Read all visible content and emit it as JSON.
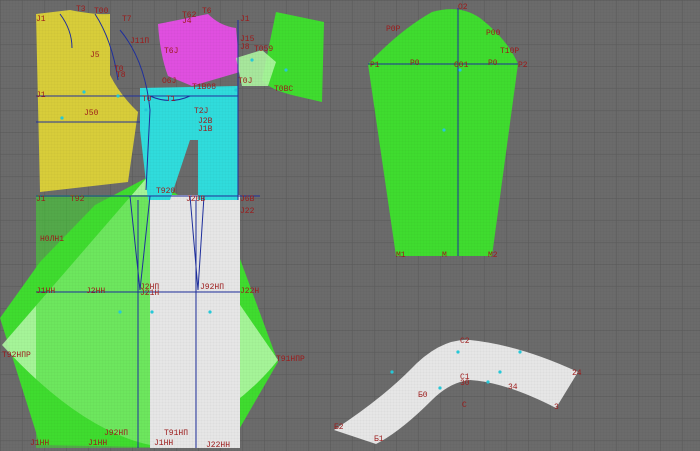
{
  "colors": {
    "background": "#6b6b6b",
    "grid": "#5b5b5b",
    "yellow": "#d8cd3a",
    "magenta": "#e04fe0",
    "cyan": "#30dcdc",
    "green": "#3fdc2f",
    "light_green": "#aef5a2",
    "white_grey": "#e6e6e6",
    "line_blue": "#1f2f9c",
    "label_red": "#9c1a1a",
    "point": "#25c8d8"
  },
  "labels": [
    {
      "text": "J1",
      "color": "red"
    },
    {
      "text": "T3",
      "color": "red"
    },
    {
      "text": "T00",
      "color": "red"
    },
    {
      "text": "T7",
      "color": "red"
    },
    {
      "text": "T62",
      "color": "red"
    },
    {
      "text": "T6",
      "color": "red"
    },
    {
      "text": "J4",
      "color": "red"
    },
    {
      "text": "J1",
      "color": "red"
    },
    {
      "text": "J11П",
      "color": "red"
    },
    {
      "text": "T6J",
      "color": "red"
    },
    {
      "text": "J15",
      "color": "red"
    },
    {
      "text": "J8",
      "color": "red"
    },
    {
      "text": "T059",
      "color": "red"
    },
    {
      "text": "T0ВС",
      "color": "red"
    },
    {
      "text": "T0J",
      "color": "red"
    },
    {
      "text": "О6J",
      "color": "red"
    },
    {
      "text": "J5",
      "color": "red"
    },
    {
      "text": "T0",
      "color": "red"
    },
    {
      "text": "T8",
      "color": "red"
    },
    {
      "text": "J1",
      "color": "red"
    },
    {
      "text": "T1",
      "color": "red"
    },
    {
      "text": "Т0",
      "color": "red"
    },
    {
      "text": "Т1В08",
      "color": "red"
    },
    {
      "text": "J50",
      "color": "red"
    },
    {
      "text": "Т2J",
      "color": "red"
    },
    {
      "text": "J2В",
      "color": "red"
    },
    {
      "text": "J1В",
      "color": "red"
    },
    {
      "text": "J1",
      "color": "red"
    },
    {
      "text": "T92",
      "color": "red"
    },
    {
      "text": "Т920",
      "color": "red"
    },
    {
      "text": "J20В",
      "color": "red"
    },
    {
      "text": "J6В",
      "color": "red"
    },
    {
      "text": "J22",
      "color": "red"
    },
    {
      "text": "Н0ЛН1",
      "color": "red"
    },
    {
      "text": "J1НН",
      "color": "red"
    },
    {
      "text": "J2НН",
      "color": "red"
    },
    {
      "text": "J2НП",
      "color": "red"
    },
    {
      "text": "J21Н",
      "color": "red"
    },
    {
      "text": "J22Н",
      "color": "red"
    },
    {
      "text": "J92НП",
      "color": "red"
    },
    {
      "text": "Т92НПР",
      "color": "red"
    },
    {
      "text": "T91НПР",
      "color": "red"
    },
    {
      "text": "J92НП",
      "color": "red"
    },
    {
      "text": "J1НН",
      "color": "red"
    },
    {
      "text": "Т91НП",
      "color": "red"
    },
    {
      "text": "J1НН",
      "color": "red"
    },
    {
      "text": "J1НН",
      "color": "red"
    },
    {
      "text": "J22НН",
      "color": "red"
    },
    {
      "text": "О2",
      "color": "red"
    },
    {
      "text": "Р0Р",
      "color": "red"
    },
    {
      "text": "Р00",
      "color": "red"
    },
    {
      "text": "Т10Р",
      "color": "red"
    },
    {
      "text": "Р1",
      "color": "red"
    },
    {
      "text": "Р0",
      "color": "red"
    },
    {
      "text": "О01",
      "color": "red"
    },
    {
      "text": "Р0",
      "color": "red"
    },
    {
      "text": "Р2",
      "color": "red"
    },
    {
      "text": "М1",
      "color": "red"
    },
    {
      "text": "М",
      "color": "red"
    },
    {
      "text": "М2",
      "color": "red"
    },
    {
      "text": "С2",
      "color": "red"
    },
    {
      "text": "С1",
      "color": "red"
    },
    {
      "text": "30",
      "color": "red"
    },
    {
      "text": "24",
      "color": "red"
    },
    {
      "text": "34",
      "color": "red"
    },
    {
      "text": "Б0",
      "color": "red"
    },
    {
      "text": "C",
      "color": "red"
    },
    {
      "text": "3",
      "color": "red"
    },
    {
      "text": "Б2",
      "color": "red"
    },
    {
      "text": "Б1",
      "color": "red"
    }
  ]
}
